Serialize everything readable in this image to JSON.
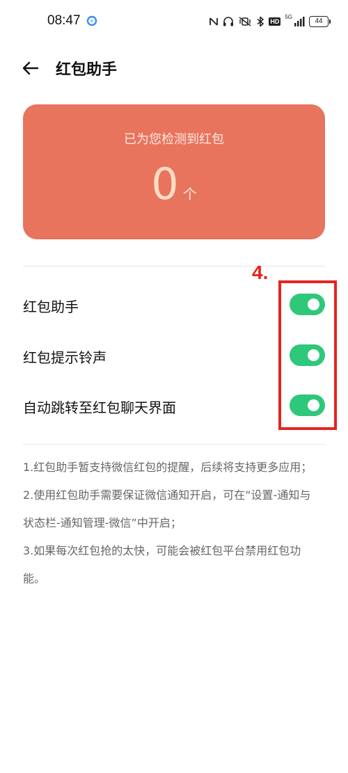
{
  "status_bar": {
    "time": "08:47",
    "network_label": "5G",
    "hd_label": "HD",
    "battery": "44",
    "icons": [
      "browser-app-icon",
      "nfc-icon",
      "headset-icon",
      "mute-vibrate-icon",
      "bluetooth-icon",
      "hd-icon",
      "signal-icon",
      "battery-icon"
    ]
  },
  "header": {
    "title": "红包助手"
  },
  "card": {
    "label": "已为您检测到红包",
    "count": "0",
    "unit": "个",
    "color": "#e8745e"
  },
  "settings": [
    {
      "label": "红包助手",
      "enabled": true
    },
    {
      "label": "红包提示铃声",
      "enabled": true
    },
    {
      "label": "自动跳转至红包聊天界面",
      "enabled": true
    }
  ],
  "notes": [
    "1.红包助手暂支持微信红包的提醒，后续将支持更多应用；",
    "2.使用红包助手需要保证微信通知开启，可在“设置-通知与",
    "状态栏-通知管理-微信”中开启；",
    "3.如果每次红包抢的太快，可能会被红包平台禁用红包功",
    "能。"
  ],
  "annotation": {
    "label": "4.",
    "color": "#e8231f"
  },
  "colors": {
    "toggle_on": "#2fc77a",
    "accent": "#e8745e"
  }
}
